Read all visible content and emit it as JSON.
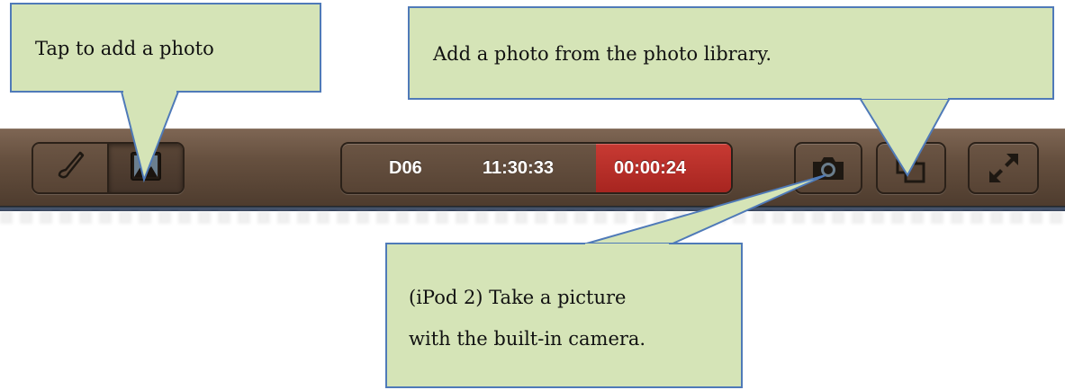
{
  "toolbar": {
    "pen_tool": {
      "icon": "pen-icon"
    },
    "photo_tool": {
      "icon": "image-icon"
    },
    "status": {
      "code": "D06",
      "clock": "11:30:33",
      "timer": "00:00:24",
      "timer_color": "#b62d28"
    },
    "camera_button": {
      "icon": "camera-icon"
    },
    "library_button": {
      "icon": "photo-library-icon"
    },
    "expand_button": {
      "icon": "expand-icon"
    }
  },
  "callouts": {
    "add_photo": "Tap to add a photo",
    "library": "Add a photo from the photo library.",
    "camera_line1": "(iPod 2) Take a picture",
    "camera_line2": "with the built-in camera."
  },
  "colors": {
    "callout_fill": "#d5e4b7",
    "callout_border": "#4f7ab8",
    "toolbar": "#66503f"
  }
}
